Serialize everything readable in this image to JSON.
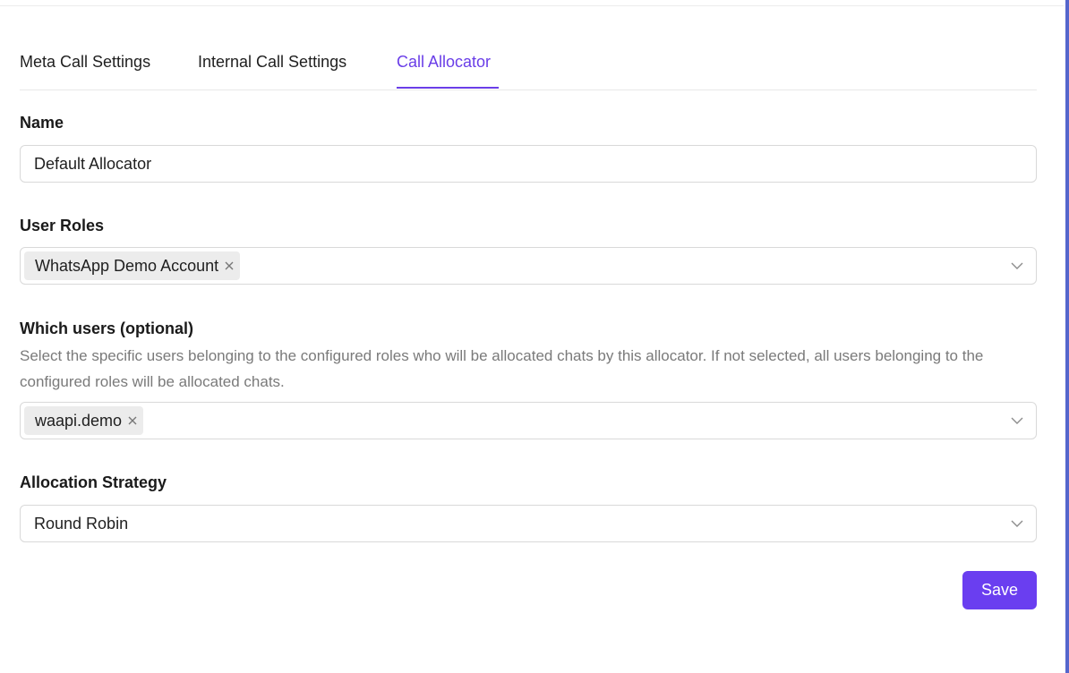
{
  "tabs": [
    {
      "label": "Meta Call Settings"
    },
    {
      "label": "Internal Call Settings"
    },
    {
      "label": "Call Allocator"
    }
  ],
  "form": {
    "name": {
      "label": "Name",
      "value": "Default Allocator"
    },
    "user_roles": {
      "label": "User Roles",
      "tags": [
        "WhatsApp Demo Account"
      ]
    },
    "which_users": {
      "label": "Which users (optional)",
      "help": "Select the specific users belonging to the configured roles who will be allocated chats by this allocator. If not selected, all users belonging to the configured roles will be allocated chats.",
      "tags": [
        "waapi.demo"
      ]
    },
    "strategy": {
      "label": "Allocation Strategy",
      "value": "Round Robin"
    },
    "save_label": "Save"
  },
  "colors": {
    "accent": "#6a3ee8",
    "button": "#6a3ef0"
  }
}
